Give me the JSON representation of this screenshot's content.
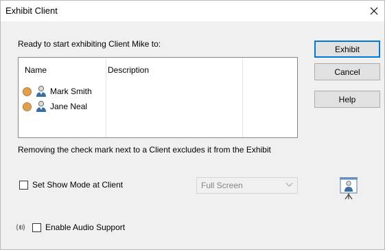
{
  "window": {
    "title": "Exhibit Client",
    "close_icon": "close-icon"
  },
  "dialog": {
    "prompt": "Ready to start exhibiting Client Mike to:",
    "list": {
      "columns": [
        "Name",
        "Description"
      ],
      "rows": [
        {
          "name": "Mark Smith",
          "description": "",
          "status_color": "#e0a050",
          "icon": "person-icon"
        },
        {
          "name": "Jane Neal",
          "description": "",
          "status_color": "#e0a050",
          "icon": "person-icon"
        }
      ]
    },
    "hint": "Removing the check mark next to a Client excludes it from the Exhibit",
    "show_mode": {
      "label": "Set Show Mode at Client",
      "checked": false,
      "select_value": "Full Screen",
      "enabled": false
    },
    "audio": {
      "label": "Enable Audio Support",
      "checked": false,
      "icon": "speaker-icon"
    },
    "presentation_icon": "presentation-screen-icon"
  },
  "buttons": {
    "exhibit": "Exhibit",
    "cancel": "Cancel",
    "help": "Help"
  }
}
